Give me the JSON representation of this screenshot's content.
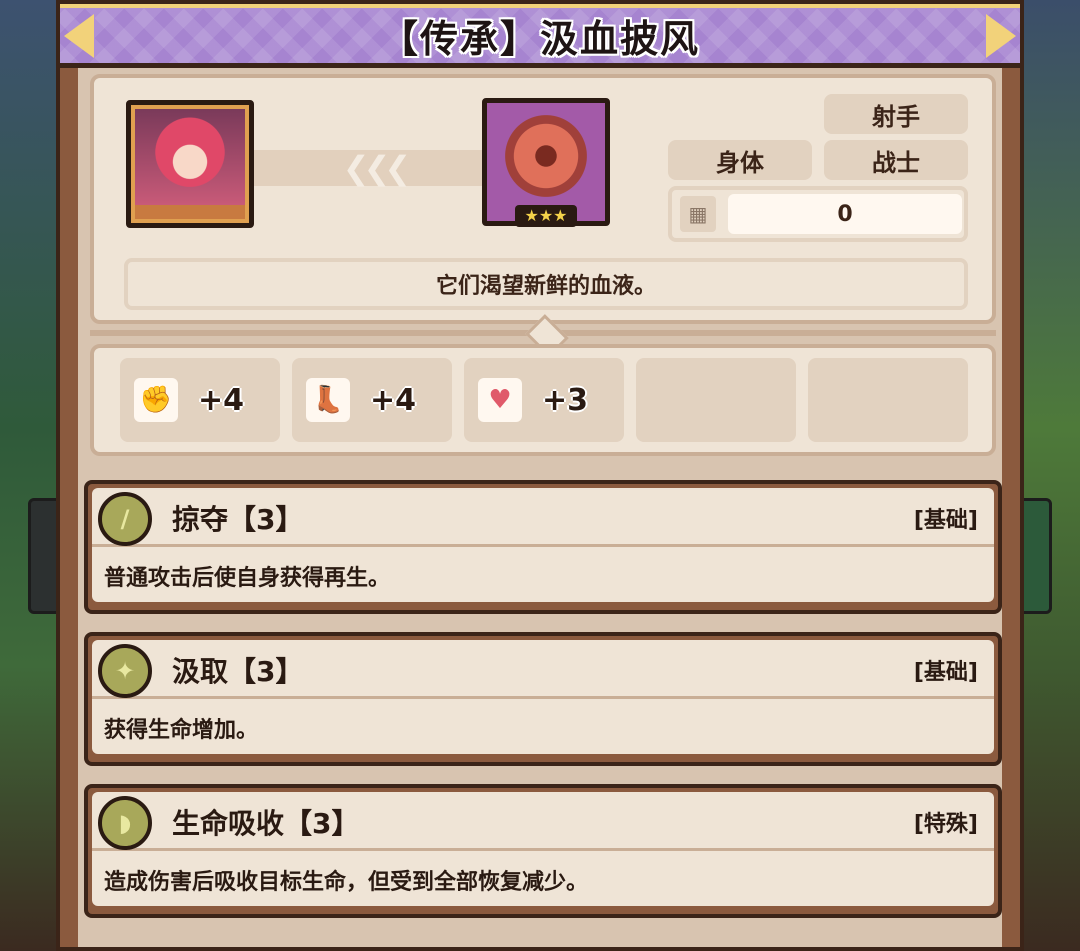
{
  "title": "【传承】汲血披风",
  "item": {
    "stars": "★★★",
    "tags": {
      "shooter": "射手",
      "body": "身体",
      "warrior": "战士"
    },
    "count": "0",
    "description": "它们渴望新鲜的血液。"
  },
  "transfer_arrows": "❮❮❮",
  "stats": [
    {
      "icon": "fist-icon",
      "glyph": "✊",
      "value": "+4"
    },
    {
      "icon": "boot-icon",
      "glyph": "👢",
      "value": "+4"
    },
    {
      "icon": "heart-icon",
      "glyph": "♥",
      "value": "+3"
    }
  ],
  "skills": [
    {
      "name": "掠夺【3】",
      "type": "[基础]",
      "desc": "普通攻击后使自身获得再生。",
      "icon_glyph": "/"
    },
    {
      "name": "汲取【3】",
      "type": "[基础]",
      "desc": "获得生命增加。",
      "icon_glyph": "✦"
    },
    {
      "name": "生命吸收【3】",
      "type": "[特殊]",
      "desc": "造成伤害后吸收目标生命，但受到全部恢复减少。",
      "icon_glyph": "◗"
    }
  ],
  "colors": {
    "title_bar": "#a684d0",
    "panel": "#8b5a3e",
    "card": "#efe4d6",
    "skill_icon": "#a8a85a"
  }
}
